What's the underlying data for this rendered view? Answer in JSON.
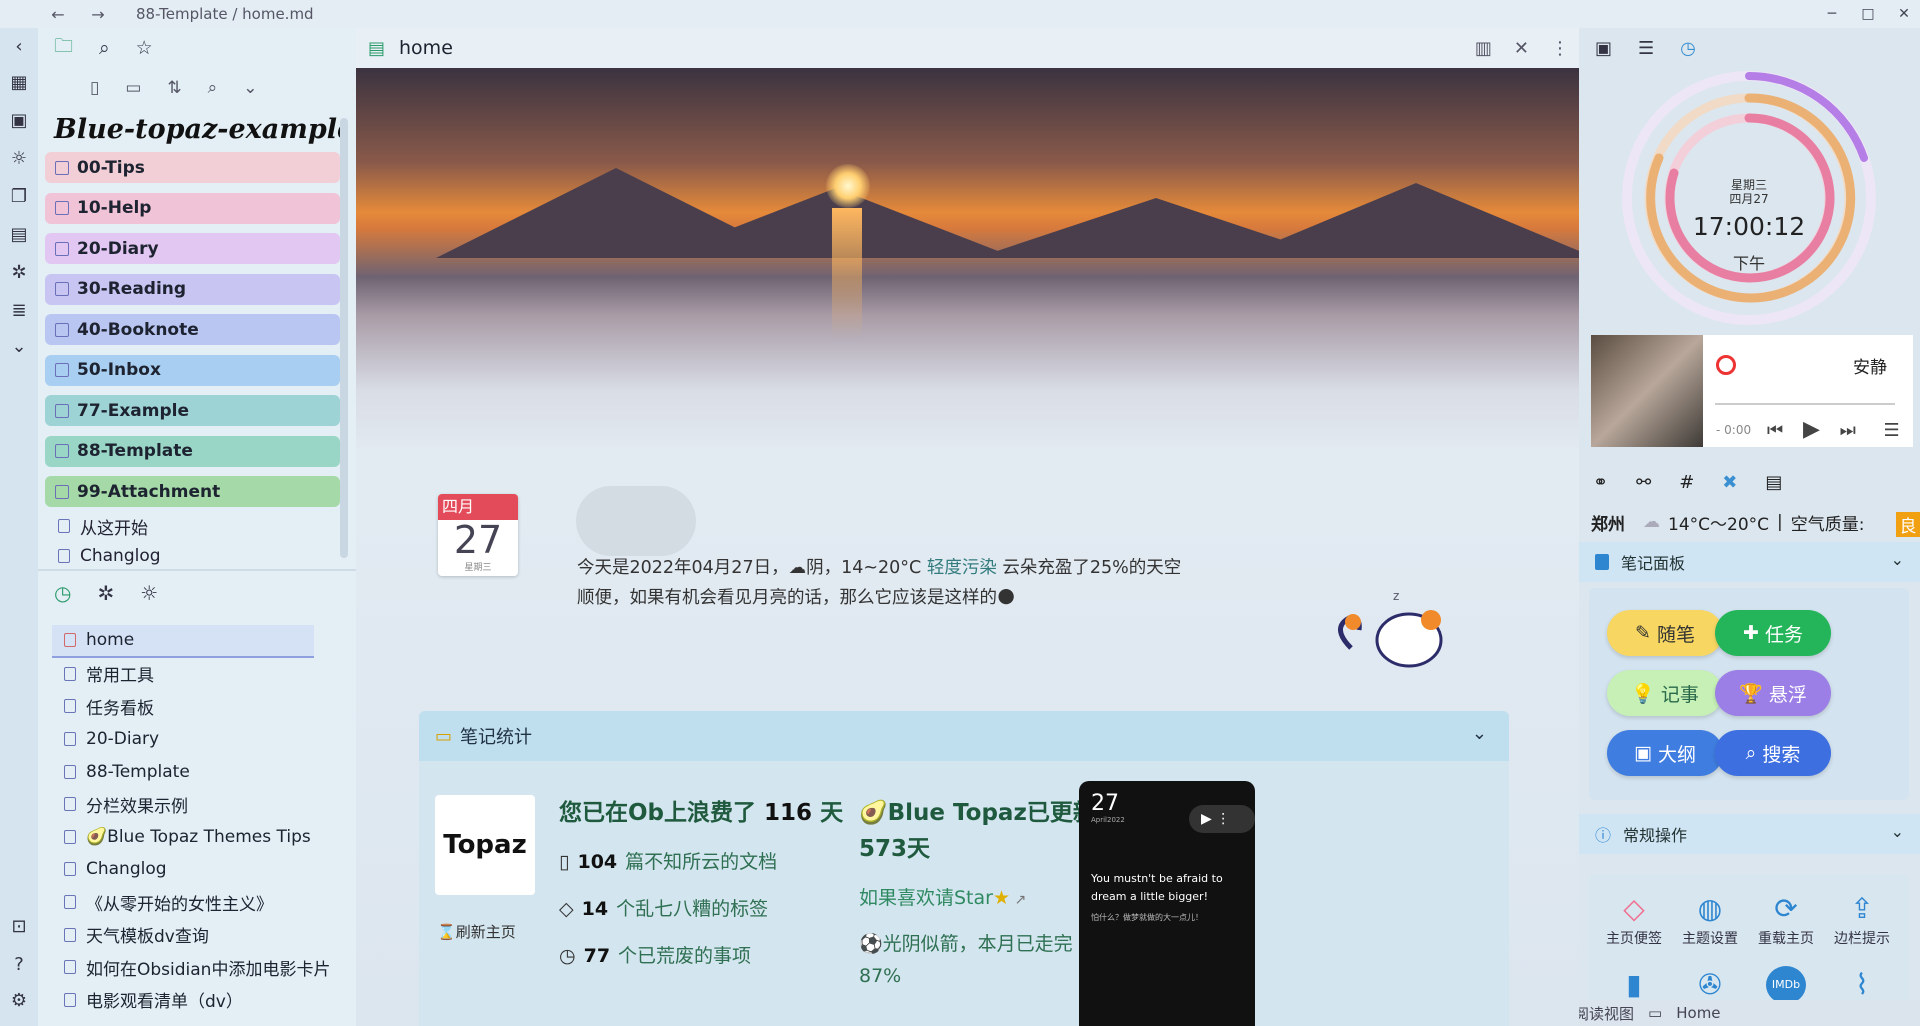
{
  "window": {
    "path": "88-Template / home.md",
    "nav_back": "←",
    "nav_forward": "→",
    "minimize": "─",
    "maximize": "□",
    "close": "✕"
  },
  "left": {
    "vault_name": "Blue-topaz-example",
    "folders": [
      {
        "label": "00-Tips",
        "color": "#f2cfd6"
      },
      {
        "label": "10-Help",
        "color": "#f1c3d7"
      },
      {
        "label": "20-Diary",
        "color": "#e2c7f2"
      },
      {
        "label": "30-Reading",
        "color": "#c9c5f2"
      },
      {
        "label": "40-Booknote",
        "color": "#b9c6f2"
      },
      {
        "label": "50-Inbox",
        "color": "#a8cef2"
      },
      {
        "label": "77-Example",
        "color": "#9ed3d6"
      },
      {
        "label": "88-Template",
        "color": "#9ad6c6"
      },
      {
        "label": "99-Attachment",
        "color": "#a5d9a7"
      }
    ],
    "files": [
      "从这开始",
      "Changlog"
    ],
    "recent": [
      "home",
      "常用工具",
      "任务看板",
      "20-Diary",
      "88-Template",
      "分栏效果示例",
      "🥑Blue Topaz Themes Tips",
      "Changlog",
      "《从零开始的女性主义》",
      "天气模板dv查询",
      "如何在Obsidian中添加电影卡片",
      "电影观看清单（dv）"
    ]
  },
  "main": {
    "tab_title": "home",
    "calendar": {
      "month": "四月",
      "day": "27",
      "weekday": "星期三"
    },
    "weather_prefix": "今天是2022年04月27日，",
    "weather_cond": "阴，14~20°C",
    "weather_pollution": "轻度污染",
    "weather_rest": "云朵充盈了25%的天空",
    "weather_line2": "顺便，如果有机会看见月亮的话，那么它应该是这样的",
    "stats": {
      "header": "笔记统计",
      "logo_text": "Topaz",
      "refresh": "刷新主页",
      "days_prefix": "您已在Ob上浪费了",
      "days": "116",
      "days_suffix": "天",
      "docs_count": "104",
      "docs_label": "篇不知所云的文档",
      "tags_count": "14",
      "tags_label": "个乱七八糟的标签",
      "tasks_count": "77",
      "tasks_label": "个已荒废的事项",
      "update_title": "🥑Blue Topaz已更新",
      "update_days": "573天",
      "star_text": "如果喜欢请Star",
      "progress_text": "⚽光阴似箭，本月已走完",
      "progress_pct": "87%",
      "phone_day": "27",
      "phone_month": "April2022",
      "phone_quote": "You mustn't be afraid to dream a little bigger!",
      "phone_zh": "怕什么？做梦就做的大一点儿！"
    }
  },
  "right": {
    "clock": {
      "weekday": "星期三",
      "date": "四月27",
      "time": "17:00:12",
      "period": "下午"
    },
    "music": {
      "song": "安静",
      "time": "- 0:00"
    },
    "weather": {
      "city": "郑州",
      "temp": "14°C～20°C",
      "aq_label": "空气质量:",
      "aq_value": "良"
    },
    "panel1_title": "笔记面板",
    "buttons": [
      "随笔",
      "任务",
      "记事",
      "悬浮",
      "大纲",
      "搜索"
    ],
    "panel2_title": "常规操作",
    "ops": [
      "主页便签",
      "主题设置",
      "重载主页",
      "边栏提示"
    ],
    "ops_icons2": [
      "IMDb"
    ],
    "status": [
      "阅读视图",
      "Home"
    ]
  }
}
